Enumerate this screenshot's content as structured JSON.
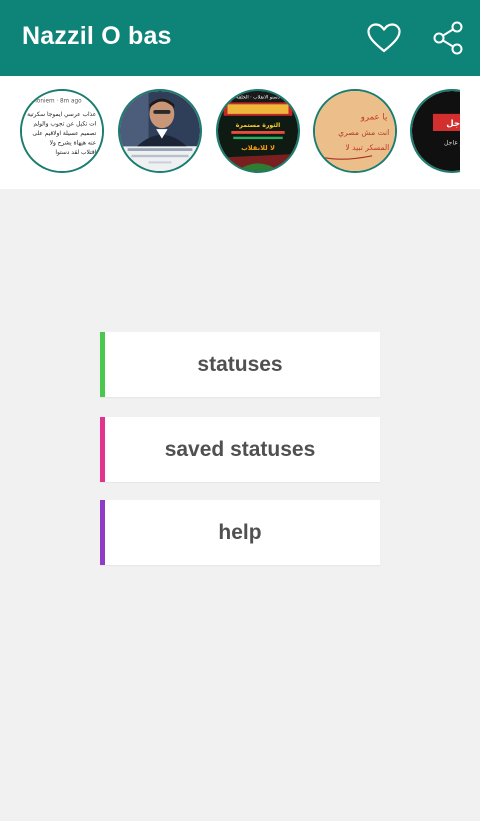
{
  "app_bar": {
    "title": "Nazzil O bas",
    "background": "#0e8378",
    "icons": [
      "heart-icon",
      "share-icon"
    ]
  },
  "status_strip": {
    "thumbnails": [
      {
        "name": "status-thumb-1",
        "text": "Shoniem · 8m ago",
        "lines": [
          "عذاب عرسي ايموجا سكرتية",
          "ات تكبل عن تجوب والولم",
          "تصميم عسيلة اولاقيم على",
          "عنه هيهاة يشرح ولا",
          "اقتلاب لقد دستوا"
        ]
      },
      {
        "name": "status-thumb-2",
        "caption": ""
      },
      {
        "name": "status-thumb-3",
        "lines": [
          "دستو الانقلاب · الحلقة",
          "الثورة مستمرة",
          "لا للانقلاب"
        ]
      },
      {
        "name": "status-thumb-4",
        "lines": [
          "يا عمرو",
          "انت مش مصري",
          "المسكر تبيد لا"
        ]
      },
      {
        "name": "status-thumb-5",
        "lines": [
          "عاجل",
          "خبر عاجل"
        ]
      }
    ]
  },
  "menu": [
    {
      "label": "statuses",
      "accent": "#4cc74e"
    },
    {
      "label": "saved statuses",
      "accent": "#e4328f"
    },
    {
      "label": "help",
      "accent": "#8e3bc6"
    }
  ]
}
